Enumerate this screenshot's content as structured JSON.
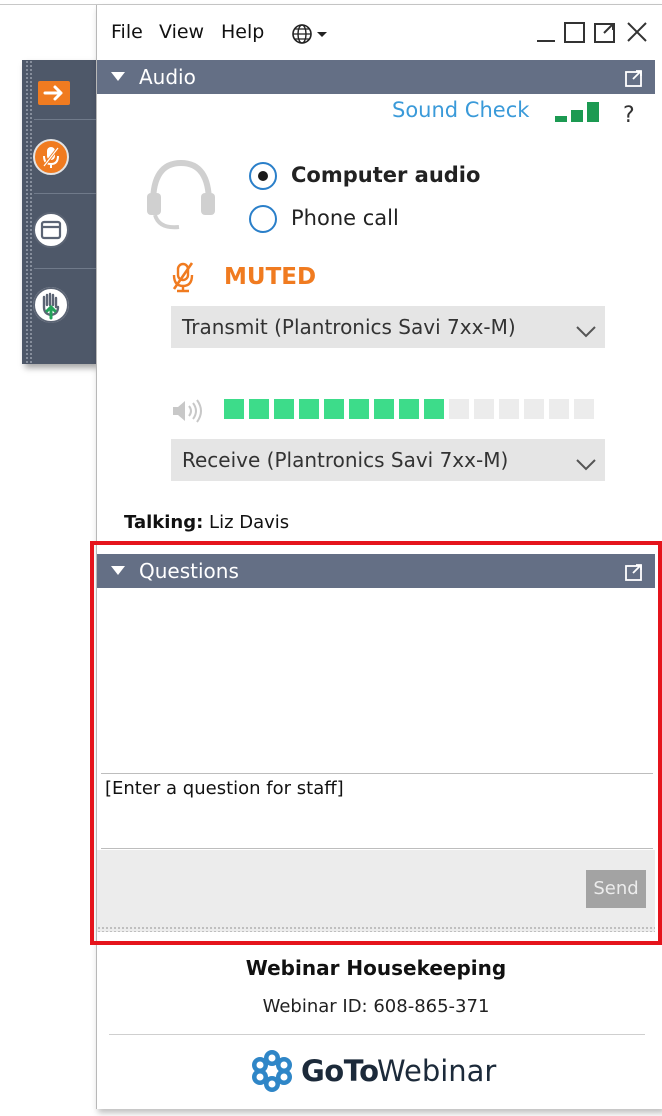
{
  "menu": {
    "file": "File",
    "view": "View",
    "help": "Help"
  },
  "audio": {
    "header": "Audio",
    "sound_check": "Sound Check",
    "help": "?",
    "computer_audio": "Computer audio",
    "phone_call": "Phone call",
    "selected": "computer_audio",
    "muted_label": "MUTED",
    "transmit_device": "Transmit (Plantronics Savi 7xx-M)",
    "receive_device": "Receive (Plantronics Savi 7xx-M)",
    "speaker_level": 0.6,
    "talking_label": "Talking:",
    "talking_name": "Liz Davis"
  },
  "questions": {
    "header": "Questions",
    "input_placeholder": "[Enter a question for staff]",
    "send_label": "Send"
  },
  "footer": {
    "title": "Webinar Housekeeping",
    "webinar_id": "Webinar ID: 608-865-371",
    "brand_bold": "GoTo",
    "brand_light": "Webinar"
  },
  "colors": {
    "accent": "#f07b20",
    "header": "#646f85",
    "link": "#3a9ad9",
    "meter": "#3ddc8a",
    "highlight": "#e5141c"
  }
}
